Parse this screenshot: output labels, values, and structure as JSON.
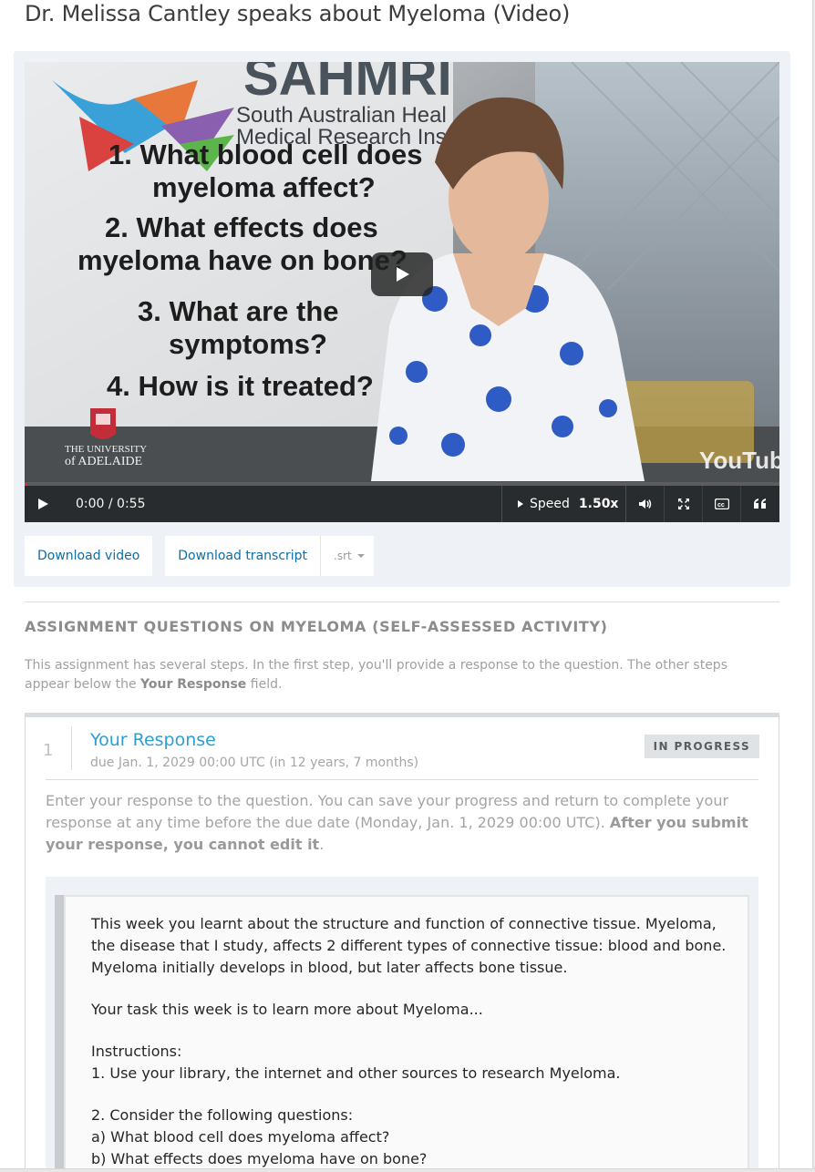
{
  "page": {
    "title": "Dr. Melissa Cantley speaks about Myeloma (Video)"
  },
  "video": {
    "thumbnail": {
      "logo_text": "SAHMRI",
      "institute_lines": [
        "South Australian Heal",
        "Medical Research Ins"
      ],
      "questions": [
        "1. What blood cell does",
        "myeloma affect?",
        "2. What effects does",
        "myeloma have on bone?",
        "3. What are the",
        "symptoms?",
        "4. How is it treated?"
      ],
      "university_line1": "THE UNIVERSITY",
      "university_line2": "of ADELAIDE",
      "youtube_logo": "YouTube"
    },
    "progress_fraction": 0.0,
    "time": "0:00 / 0:55",
    "speed_label": "Speed",
    "speed_value": "1.50x",
    "icons": [
      "play-icon",
      "volume-icon",
      "fullscreen-icon",
      "closed-captions-icon",
      "transcript-quote-icon"
    ]
  },
  "downloads": {
    "video_label": "Download video",
    "transcript_label": "Download transcript",
    "transcript_format": ".srt"
  },
  "assignment": {
    "title": "ASSIGNMENT QUESTIONS ON MYELOMA (SELF-ASSESSED ACTIVITY)",
    "intro_before": "This assignment has several steps. In the first step, you'll provide a response to the question. The other steps appear below the ",
    "intro_bold": "Your Response",
    "intro_after": " field.",
    "step": {
      "number": "1",
      "title": "Your Response",
      "due": "due Jan. 1, 2029 00:00 UTC (in 12 years, 7 months)",
      "status": "IN PROGRESS",
      "instructions_plain": "Enter your response to the question. You can save your progress and return to complete your response at any time before the due date (Monday, Jan. 1, 2029 00:00 UTC). ",
      "instructions_bold": "After you submit your response, you cannot edit it",
      "instructions_end": ".",
      "prompt": {
        "para1": "This week you learnt about the structure and function of connective tissue. Myeloma, the disease that I study, affects 2 different types of connective tissue: blood and bone. Myeloma initially develops in blood, but later affects bone tissue.",
        "para2": "Your task this week is to learn more about Myeloma...",
        "instructions_heading": "Instructions:",
        "instruction1": "1. Use your library, the internet and other sources to research Myeloma.",
        "instruction2": "2. Consider the following questions:",
        "question_a": "a) What blood cell does myeloma affect?",
        "question_b": "b) What effects does myeloma have on bone?"
      }
    }
  },
  "colors": {
    "link_blue": "#0a6ea8",
    "step_title_blue": "#2a9fd6",
    "control_bar": "#282c2e",
    "panel_bg": "#eef1f5",
    "progress_red": "#c9333c"
  }
}
